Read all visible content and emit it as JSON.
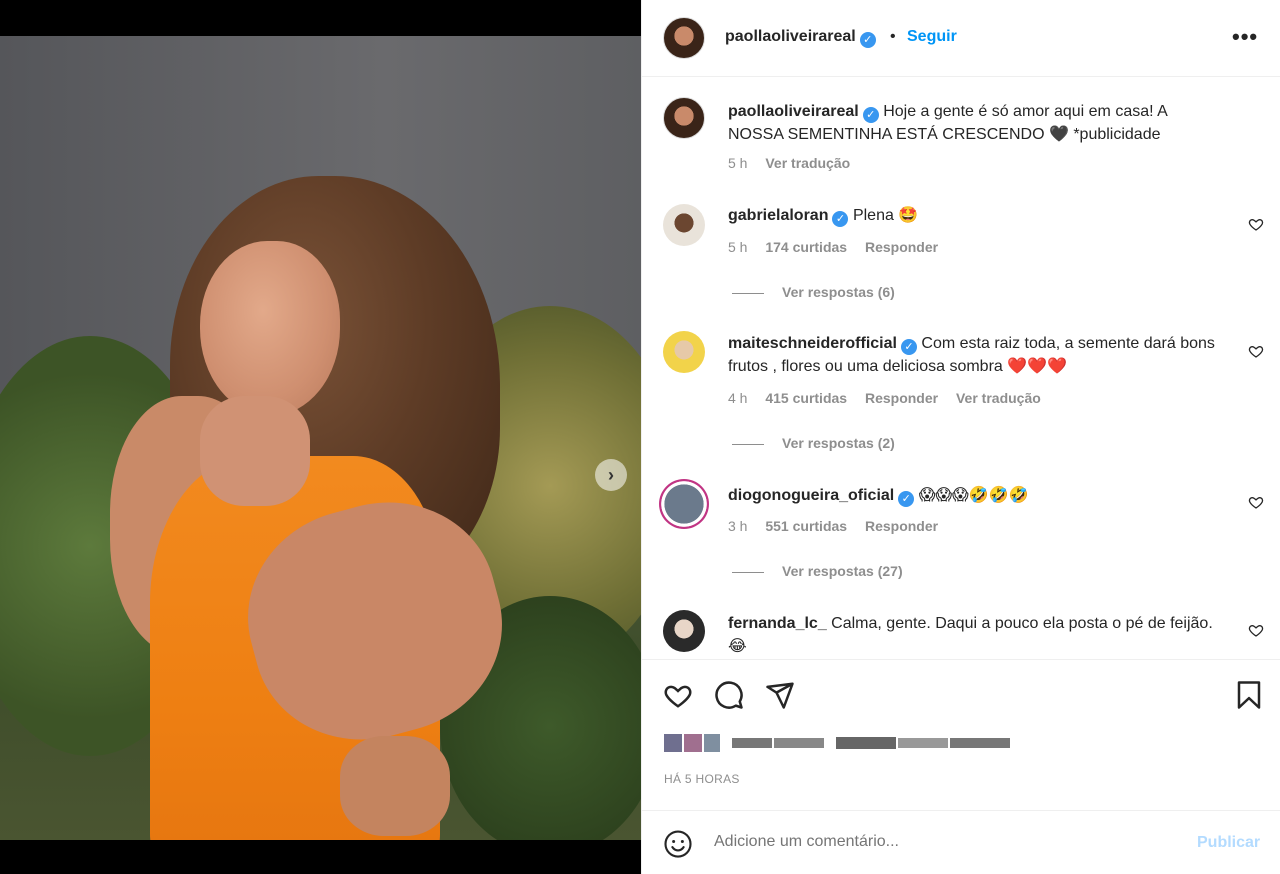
{
  "post": {
    "author": "paollaoliveirareal",
    "follow_label": "Seguir",
    "bullet": "•",
    "more_label": "•••",
    "verified_mark": "✓",
    "caption": {
      "username": "paollaoliveirareal",
      "text": "Hoje a gente é só amor aqui em casa! A NOSSA SEMENTINHA ESTÁ CRESCENDO 🖤 *publicidade",
      "time": "5 h",
      "translate": "Ver tradução"
    },
    "carousel": {
      "slide": 1,
      "total": 3,
      "next_glyph": "›"
    }
  },
  "comments": [
    {
      "username": "gabrielaloran",
      "text": "Plena 🤩",
      "time": "5 h",
      "likes": "174 curtidas",
      "reply": "Responder",
      "view_replies": "Ver respostas (6)"
    },
    {
      "username": "maiteschneiderofficial",
      "text": "Com esta raiz toda, a semente dará bons frutos , flores ou uma deliciosa sombra ❤️❤️❤️",
      "time": "4 h",
      "likes": "415 curtidas",
      "reply": "Responder",
      "translate": "Ver tradução",
      "view_replies": "Ver respostas (2)"
    },
    {
      "username": "diogonogueira_oficial",
      "text": "😱😱😱🤣🤣🤣",
      "time": "3 h",
      "likes": "551 curtidas",
      "reply": "Responder",
      "view_replies": "Ver respostas (27)"
    },
    {
      "username": "fernanda_lc_",
      "text": "Calma, gente. Daqui a pouco ela posta o pé de feijão. 😂"
    }
  ],
  "footer": {
    "time_ago": "HÁ 5 HORAS",
    "comment_placeholder": "Adicione um comentário...",
    "publish_label": "Publicar"
  },
  "colors": {
    "accent": "#0095f6",
    "verified": "#3897f0",
    "text": "#262626",
    "muted": "#8e8e8e",
    "dress": "#ee7f12"
  }
}
